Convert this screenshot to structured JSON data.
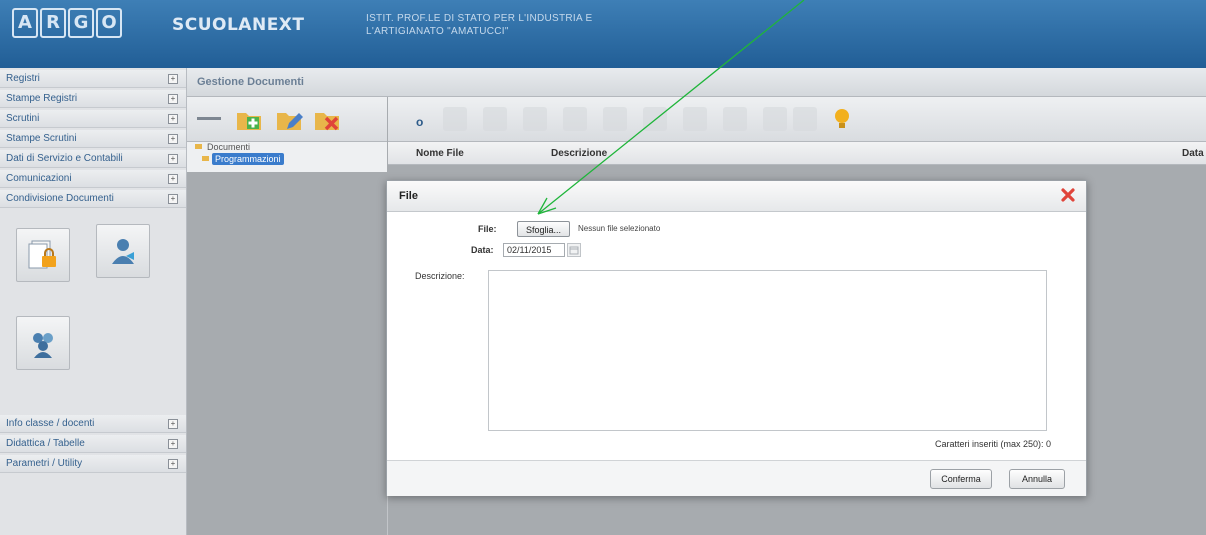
{
  "header": {
    "logo_letters": [
      "A",
      "R",
      "G",
      "O"
    ],
    "app_name": "SCUOLANEXT",
    "school_line1": "ISTIT. PROF.LE DI STATO PER L'INDUSTRIA E",
    "school_line2": "L'ARTIGIANATO \"AMATUCCI\""
  },
  "sidebar": {
    "items_top": [
      {
        "label": "Registri"
      },
      {
        "label": "Stampe Registri"
      },
      {
        "label": "Scrutini"
      },
      {
        "label": "Stampe Scrutini"
      },
      {
        "label": "Dati di Servizio e Contabili"
      },
      {
        "label": "Comunicazioni"
      },
      {
        "label": "Condivisione Documenti"
      }
    ],
    "items_bottom": [
      {
        "label": "Info classe / docenti"
      },
      {
        "label": "Didattica / Tabelle"
      },
      {
        "label": "Parametri / Utility"
      }
    ],
    "toggle_symbol": "+"
  },
  "main": {
    "title": "Gestione Documenti",
    "tree": {
      "root": "Documenti",
      "selected_node": "Programmazioni"
    },
    "files_header": {
      "col_name": "Nome File",
      "col_desc": "Descrizione",
      "col_date": "Data"
    },
    "refresh_glyph": "o"
  },
  "dialog": {
    "title": "File",
    "file_label": "File:",
    "choose_button": "Sfoglia...",
    "no_file_text": "Nessun file selezionato",
    "date_label": "Data:",
    "date_value": "02/11/2015",
    "description_label": "Descrizione:",
    "description_value": "",
    "counter_text": "Caratteri inseriti (max 250): 0",
    "confirm_button": "Conferma",
    "cancel_button": "Annulla"
  },
  "colors": {
    "header_blue": "#2a6aa3",
    "selection_blue": "#3a7ccc",
    "close_red": "#e0443a",
    "arrow_green": "#1fb53a"
  }
}
